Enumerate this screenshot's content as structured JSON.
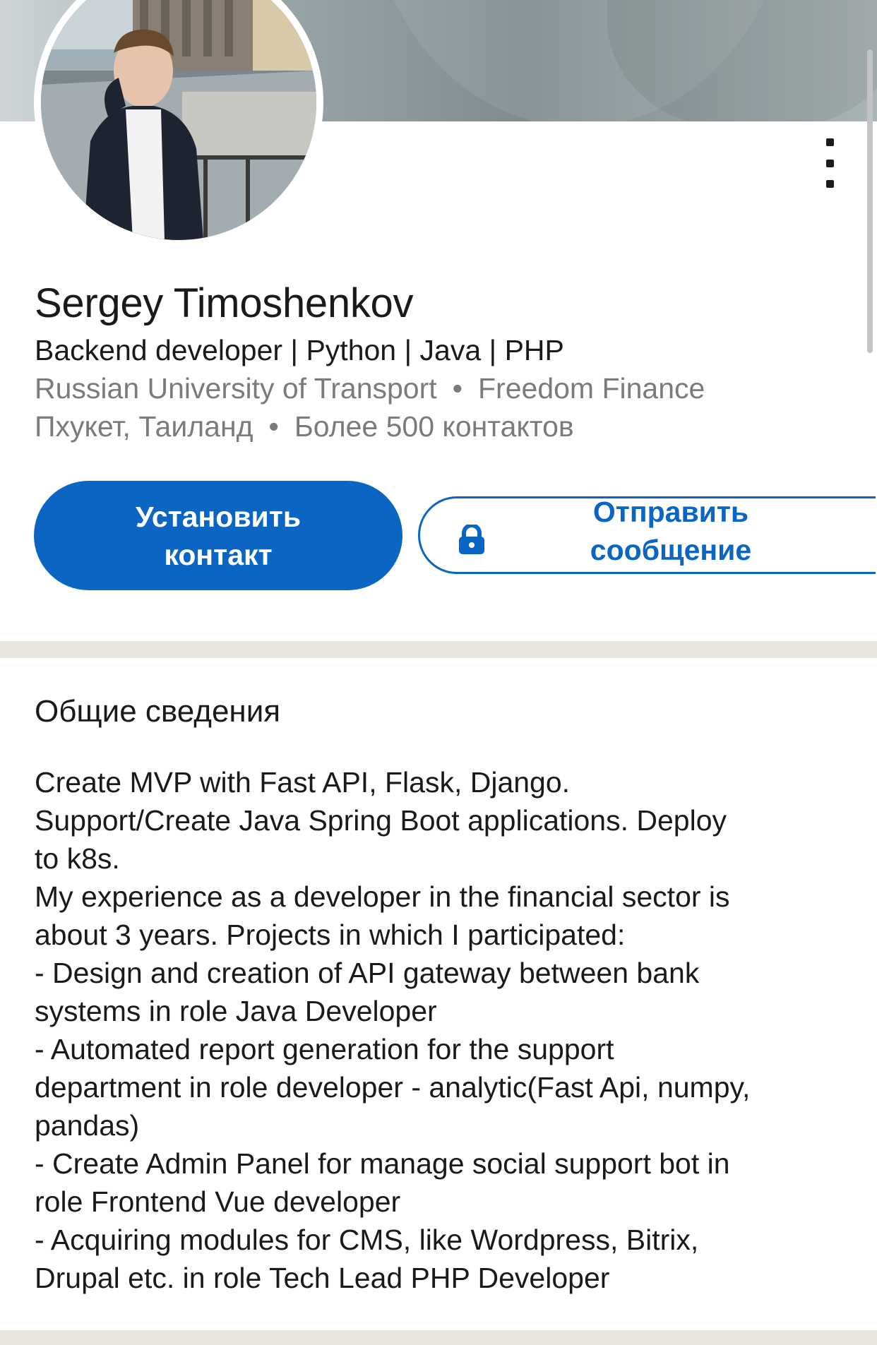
{
  "profile": {
    "name": "Sergey Timoshenkov",
    "headline": "Backend developer | Python | Java | PHP",
    "education": "Russian University of Transport",
    "company": "Freedom Finance",
    "location": "Пхукет, Таиланд",
    "connections": "Более 500 контактов",
    "separator": "•"
  },
  "actions": {
    "connect_label": "Установить контакт",
    "message_label": "Отправить сообщение"
  },
  "about": {
    "title": "Общие сведения",
    "lines": [
      "Create MVP with Fast API, Flask, Django.",
      "Support/Create Java Spring Boot applications. Deploy",
      "to k8s.",
      "My experience as a developer in the financial sector is",
      "about 3 years. Projects in which I participated:",
      "- Design and creation of API gateway between bank",
      "systems in role Java Developer",
      "- Automated report generation for the support",
      "department in role developer - analytic(Fast Api, numpy,",
      "pandas)",
      "- Create Admin Panel for manage social support bot in",
      "role Frontend Vue developer",
      "- Acquiring modules for CMS, like Wordpress, Bitrix,",
      "Drupal etc. in role Tech Lead PHP Developer"
    ]
  },
  "icons": {
    "more": "more-vertical-icon",
    "lock": "lock-icon"
  },
  "colors": {
    "accent": "#0a66c2",
    "divider": "#e9e5df",
    "secondary_text": "#7b7b7b"
  }
}
